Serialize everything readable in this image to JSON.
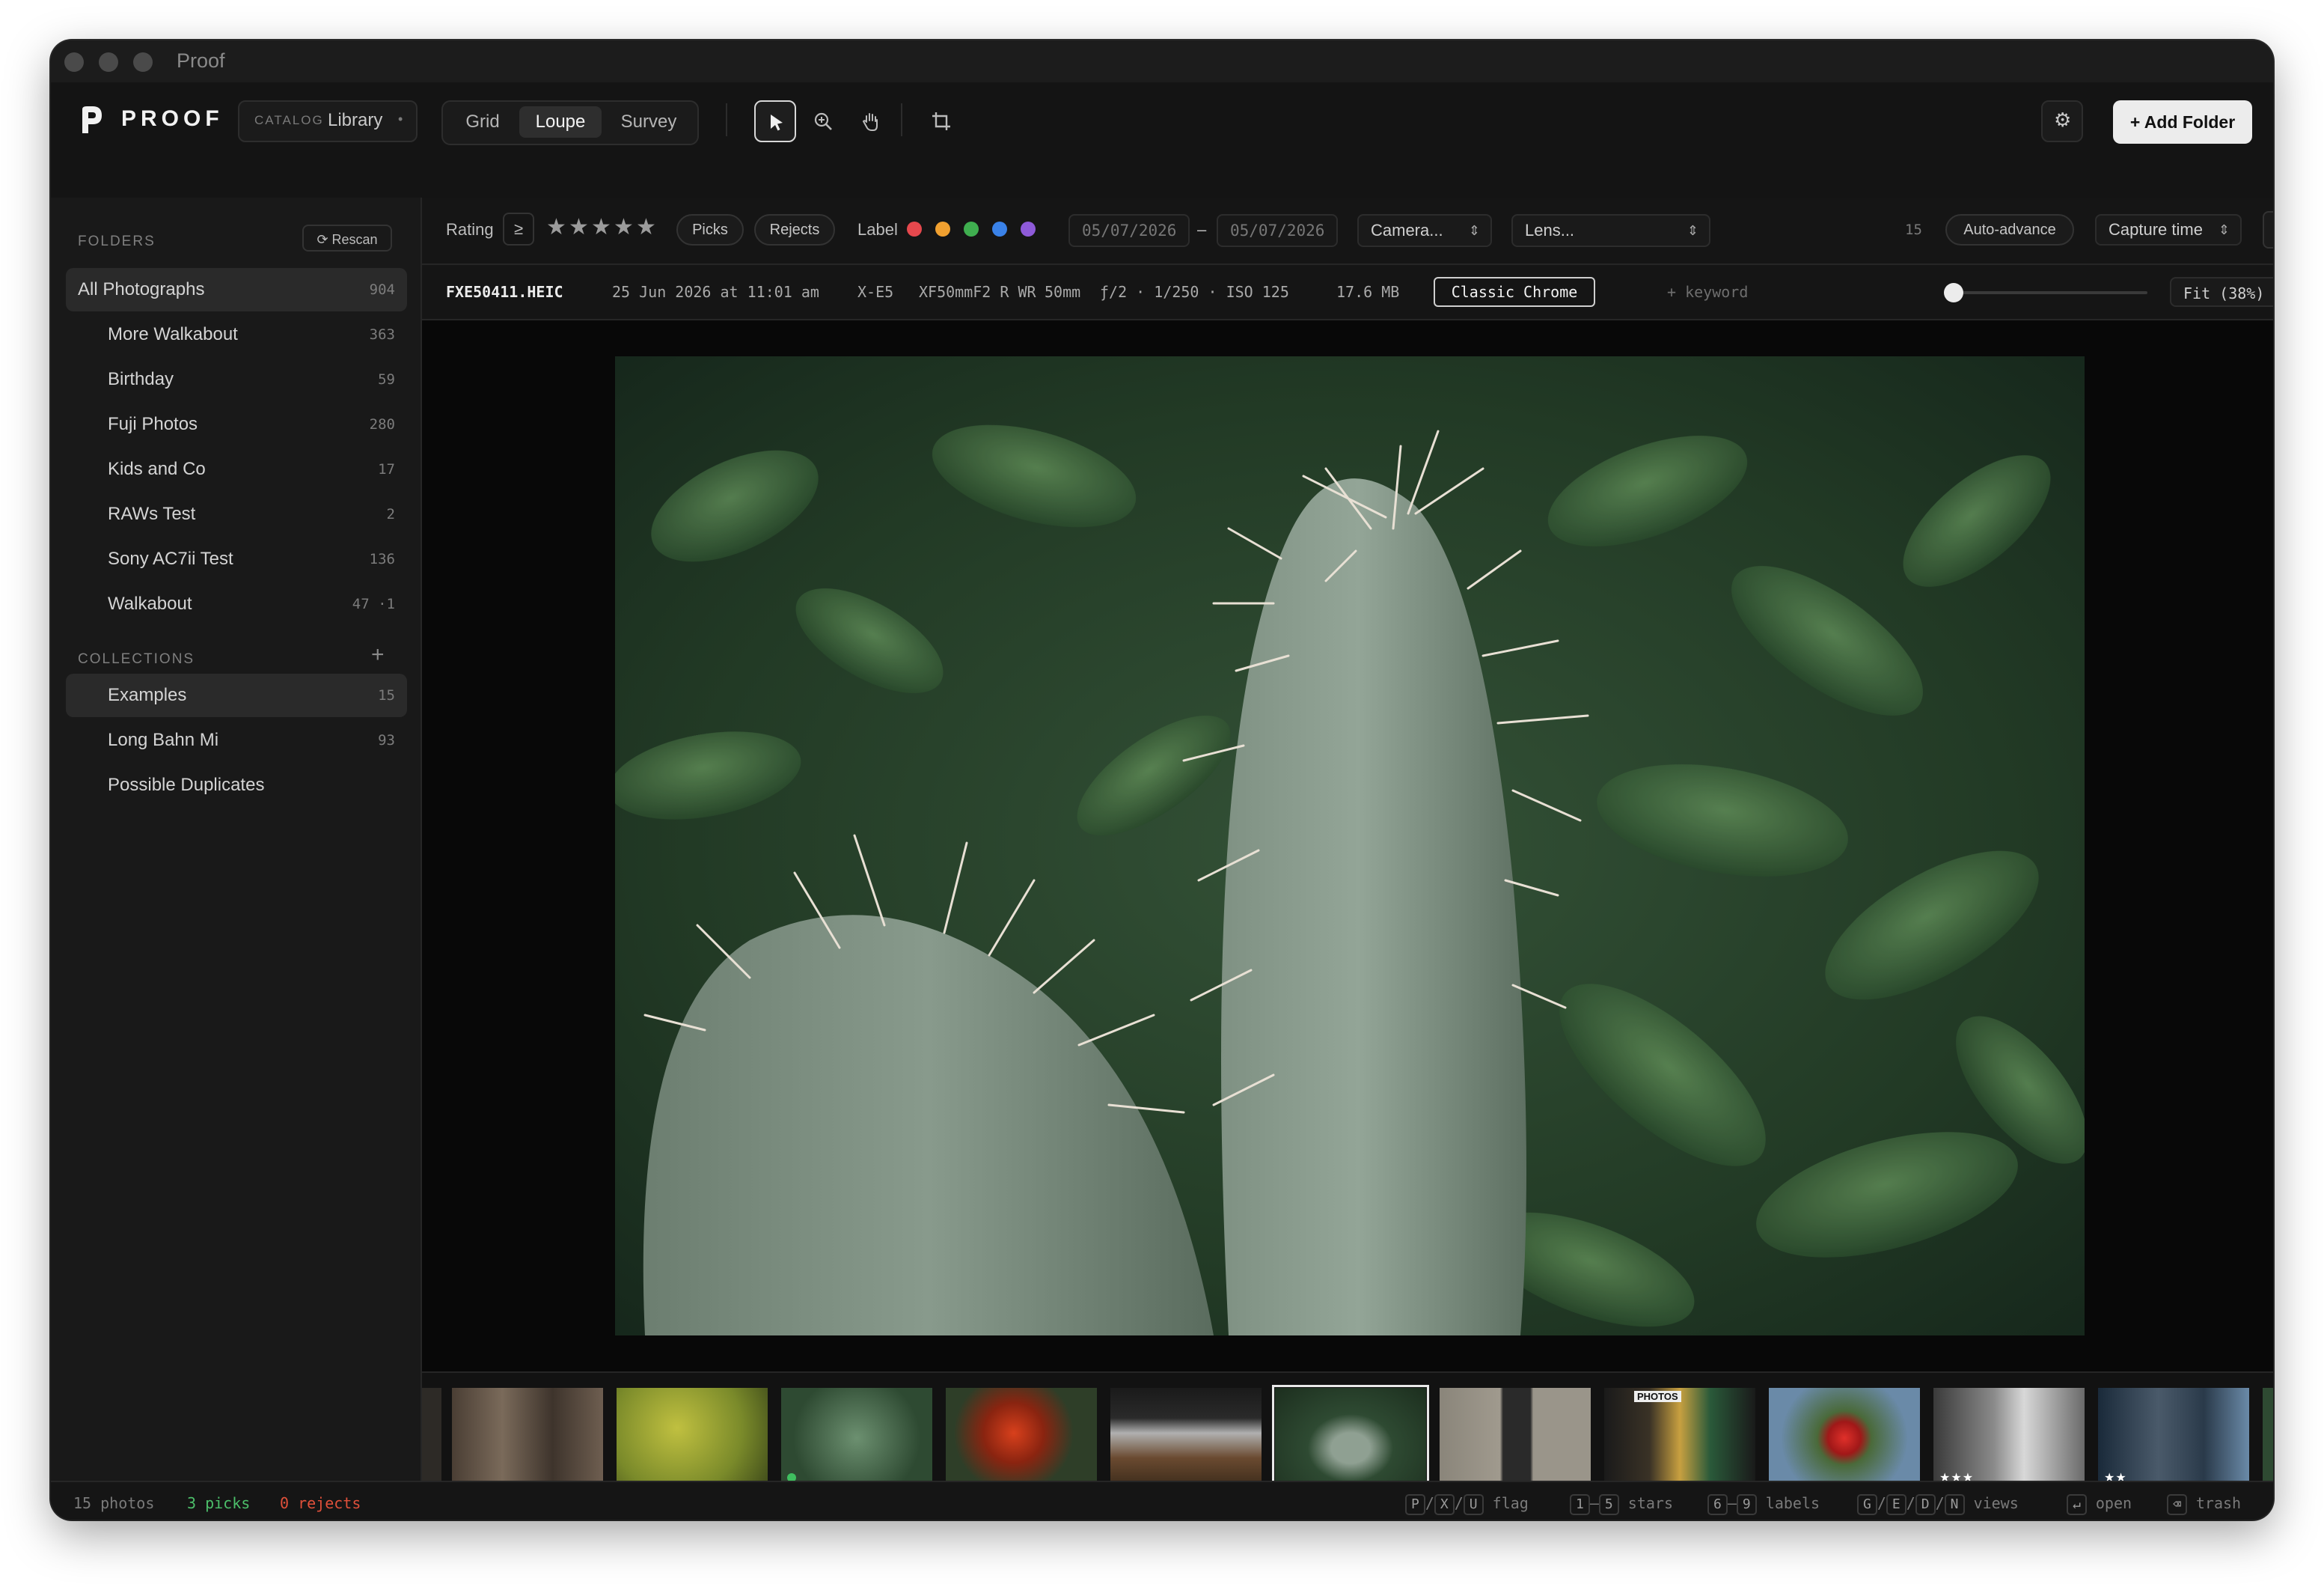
{
  "window": {
    "title": "Proof"
  },
  "brand": {
    "name": "PROOF"
  },
  "catalog": {
    "label": "CATALOG",
    "value": "Library",
    "more": "•"
  },
  "views": [
    {
      "label": "Grid",
      "active": false
    },
    {
      "label": "Loupe",
      "active": true
    },
    {
      "label": "Survey",
      "active": false
    }
  ],
  "tools": [
    "select-arrow-icon",
    "zoom-icon",
    "hand-icon",
    "crop-icon"
  ],
  "toolbar": {
    "settings_icon": "⚙",
    "add_folder": "+ Add Folder"
  },
  "sidebar": {
    "folders_title": "FOLDERS",
    "rescan": "⟳ Rescan",
    "collections_title": "COLLECTIONS",
    "add_collection": "+",
    "folders": [
      {
        "name": "All Photographs",
        "count": "904",
        "selected": true
      },
      {
        "name": "More Walkabout",
        "count": "363"
      },
      {
        "name": "Birthday",
        "count": "59"
      },
      {
        "name": "Fuji Photos",
        "count": "280"
      },
      {
        "name": "Kids and Co",
        "count": "17"
      },
      {
        "name": "RAWs Test",
        "count": "2"
      },
      {
        "name": "Sony AC7ii Test",
        "count": "136"
      },
      {
        "name": "Walkabout",
        "count": "47 ·1"
      }
    ],
    "collections": [
      {
        "name": "Examples",
        "count": "15",
        "selected": true
      },
      {
        "name": "Long Bahn Mi",
        "count": "93"
      },
      {
        "name": "Possible Duplicates",
        "count": ""
      }
    ]
  },
  "filters": {
    "rating_label": "Rating",
    "rating_op": "≥",
    "stars": [
      "★",
      "★",
      "★",
      "★",
      "★"
    ],
    "picks": "Picks",
    "rejects": "Rejects",
    "label_label": "Label",
    "label_colors": [
      "#e5484d",
      "#f0a030",
      "#3fae4f",
      "#3a82e8",
      "#8e5ad8"
    ],
    "date_from": "05/07/2026",
    "date_sep": "–",
    "date_to": "05/07/2026",
    "camera": "Camera...",
    "lens": "Lens...",
    "count": "15",
    "auto_advance": "Auto-advance",
    "sort": "Capture time",
    "sort_dir": "↑"
  },
  "info": {
    "filename": "FXE50411.HEIC",
    "datetime": "25 Jun 2026 at 11:01 am",
    "camera": "X-E5",
    "lens": "XF50mmF2 R WR",
    "focal": "50mm",
    "exposure": "ƒ/2 · 1/250 · ISO 125",
    "size": "17.6 MB",
    "preset": "Classic Chrome",
    "keyword": "+ keyword",
    "zoom": "Fit (38%)",
    "zoom_level": 0.0
  },
  "filmstrip": {
    "thumbnails": [
      {
        "name": "tree-bark",
        "stars": ""
      },
      {
        "name": "yellow-leaves",
        "stars": ""
      },
      {
        "name": "green-shrub",
        "stars": "",
        "picked": true
      },
      {
        "name": "red-flowers",
        "stars": ""
      },
      {
        "name": "cooking-pot",
        "stars": ""
      },
      {
        "name": "cactus",
        "stars": "",
        "selected": true
      },
      {
        "name": "building-door",
        "stars": ""
      },
      {
        "name": "photo-booth",
        "stars": "",
        "sign": "PHOTOS"
      },
      {
        "name": "red-rose",
        "stars": ""
      },
      {
        "name": "street-buildings",
        "stars": "★★★"
      },
      {
        "name": "tower-block",
        "stars": "★★"
      }
    ]
  },
  "status": {
    "photos": "15 photos",
    "picks": "3 picks",
    "rejects": "0 rejects",
    "hints": [
      {
        "keys": [
          "P",
          "X",
          "U"
        ],
        "sep": "/",
        "label": "flag"
      },
      {
        "keys": [
          "1",
          "5"
        ],
        "sep": "–",
        "label": "stars"
      },
      {
        "keys": [
          "6",
          "9"
        ],
        "sep": "–",
        "label": "labels"
      },
      {
        "keys": [
          "G",
          "E",
          "D",
          "N"
        ],
        "sep": "/",
        "label": "views"
      },
      {
        "keys": [
          "↵"
        ],
        "sep": "",
        "label": "open"
      },
      {
        "keys": [
          "⌫"
        ],
        "sep": "",
        "label": "trash"
      }
    ]
  }
}
